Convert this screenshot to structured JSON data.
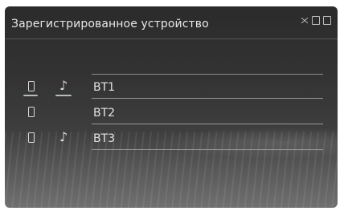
{
  "header": {
    "title": "Зарегистрированное устройство"
  },
  "devices": [
    {
      "name": "BT1",
      "phone_icon": "phone-icon",
      "music_icon": "music-note-icon",
      "has_music": true,
      "connected": true
    },
    {
      "name": "BT2",
      "phone_icon": "phone-icon",
      "music_icon": "",
      "has_music": false,
      "connected": false
    },
    {
      "name": "BT3",
      "phone_icon": "phone-icon",
      "music_icon": "music-note-icon",
      "has_music": true,
      "connected": false
    }
  ],
  "music_glyph": "♪",
  "colors": {
    "background": "#333333",
    "text": "#e4e4e4",
    "connected_indicator": "#9fc2d8"
  }
}
